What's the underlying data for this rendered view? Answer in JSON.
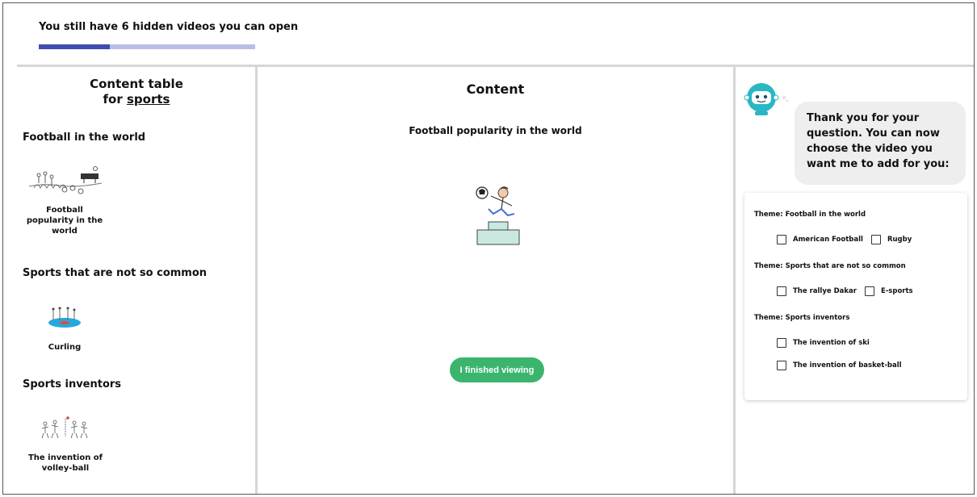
{
  "header": {
    "hidden_videos_text": "You still have 6 hidden videos you can open",
    "progress_fraction": 0.33
  },
  "toc": {
    "title_prefix": "Content table",
    "title_for": "for",
    "title_subject": "sports",
    "sections": [
      {
        "heading": "Football in the world",
        "items": [
          {
            "caption": "Football popularity in the world",
            "icon": "football-crowd-icon"
          }
        ]
      },
      {
        "heading": "Sports that are not so common",
        "items": [
          {
            "caption": "Curling",
            "icon": "curling-icon"
          }
        ]
      },
      {
        "heading": "Sports inventors",
        "items": [
          {
            "caption": "The invention of volley-ball",
            "icon": "volleyball-players-icon"
          }
        ]
      }
    ]
  },
  "main": {
    "title": "Content",
    "video_title": "Football popularity in the world",
    "video_icon": "football-podium-icon",
    "finish_button": "I finished viewing",
    "accent": "#3bb56e"
  },
  "assistant": {
    "avatar_icon": "robot-icon",
    "message": "Thank you for your question. You can now choose the video you want me to add for you:",
    "themes": [
      {
        "label": "Theme: Football in the world",
        "options": [
          "American Football",
          "Rugby"
        ]
      },
      {
        "label": "Theme: Sports that are not so common",
        "options": [
          "The rallye Dakar",
          "E-sports"
        ]
      },
      {
        "label": "Theme: Sports inventors",
        "options": [
          "The invention of ski",
          "The invention of basket-ball"
        ]
      }
    ]
  },
  "colors": {
    "progress_fill": "#3f4db0",
    "progress_track": "#b9bde6",
    "robot": "#2ab7c4"
  }
}
